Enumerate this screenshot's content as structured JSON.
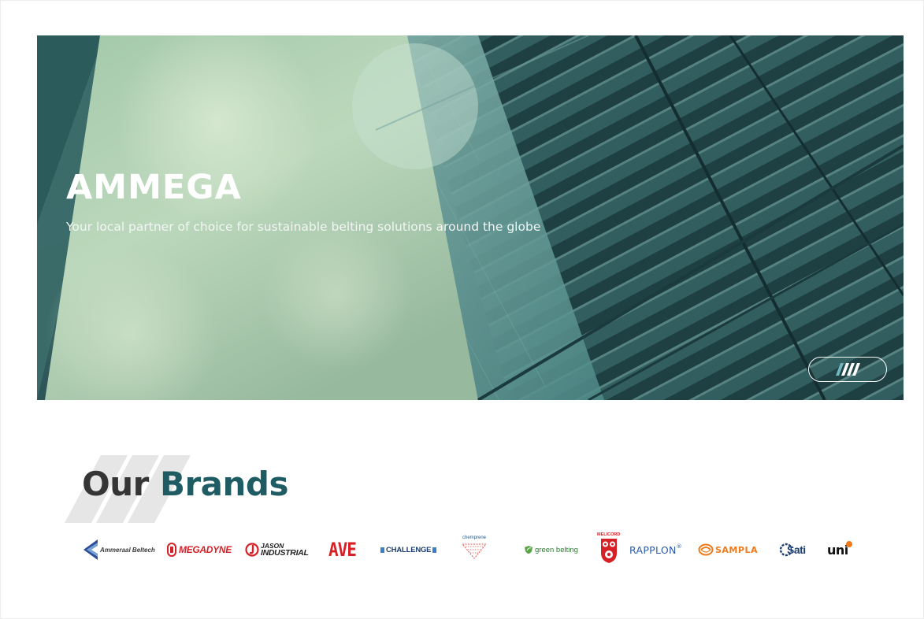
{
  "hero": {
    "title": "AMMEGA",
    "subtitle": "Your local partner of choice for sustainable belting solutions around the globe",
    "slider_icon": "slash-lines-icon"
  },
  "brands": {
    "heading_part1": "Our",
    "heading_part2": "Brands",
    "logos": [
      {
        "name": "Ammeraal Beltech",
        "icon": "ammeraal-logo-icon"
      },
      {
        "name": "MEGADYNE",
        "icon": "megadyne-logo-icon"
      },
      {
        "name_top": "JASON",
        "name_bottom": "INDUSTRIAL",
        "icon": "jason-logo-icon"
      },
      {
        "name": "AVE"
      },
      {
        "name": "CHALLENGE"
      },
      {
        "name": "chemprene",
        "icon": "chemprene-logo-icon"
      },
      {
        "name": "green belting",
        "icon": "leaf-shield-icon"
      },
      {
        "name": "MELICORD",
        "icon": "melicord-logo-icon"
      },
      {
        "name": "RAPPLON",
        "mark": "®"
      },
      {
        "name": "SAMPLA",
        "icon": "sampla-logo-icon"
      },
      {
        "name": "Sati",
        "icon": "sati-gear-icon"
      },
      {
        "name": "uni",
        "icon": "uni-dot-icon"
      }
    ]
  },
  "colors": {
    "brand_dark": "#1f5b63",
    "heading_dark": "#353535",
    "megadyne_red": "#d71f26",
    "sampla_orange": "#f07a1a",
    "rapplon_blue": "#2b5aa8"
  }
}
